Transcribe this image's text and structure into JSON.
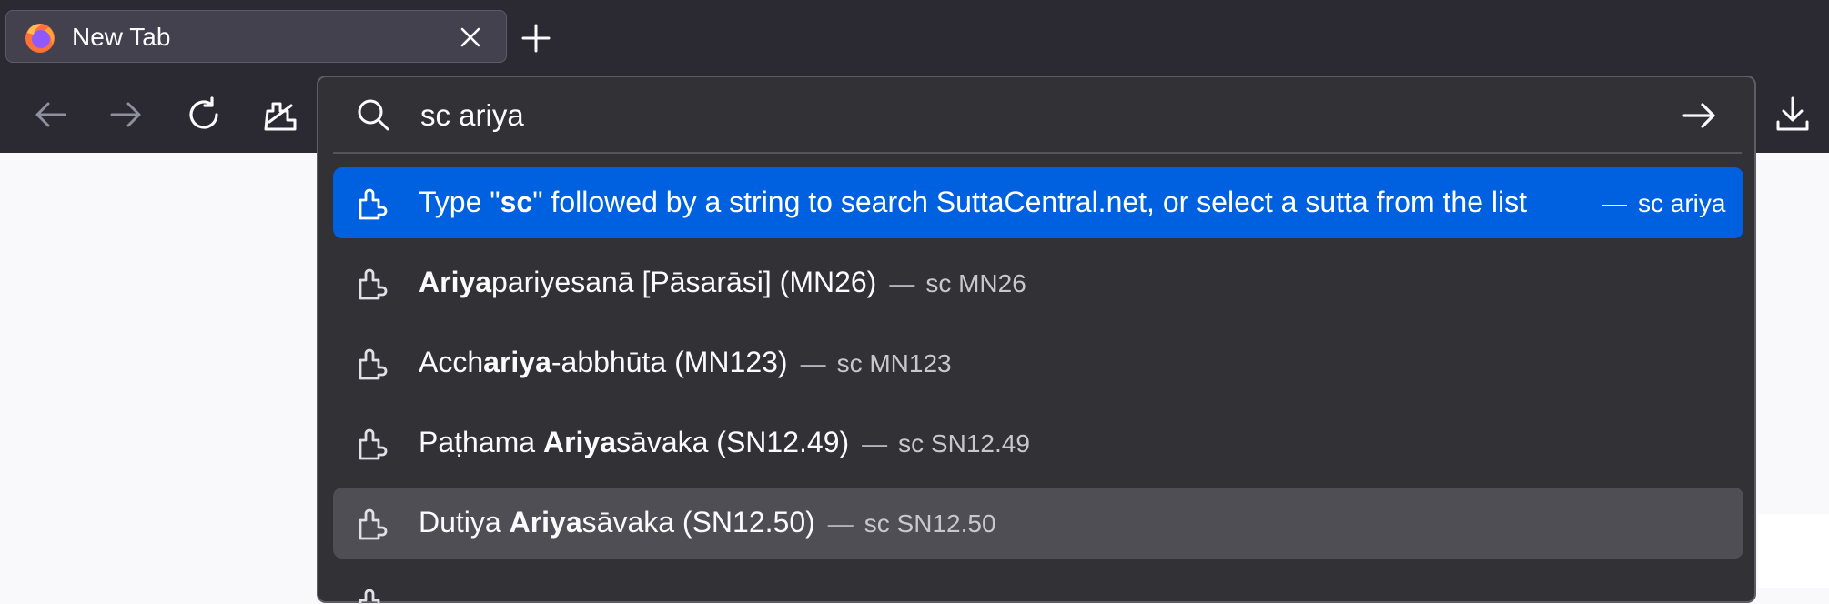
{
  "tab": {
    "title": "New Tab"
  },
  "urlbar": {
    "value": "sc ariya"
  },
  "results": [
    {
      "prefix": "Type \"",
      "bold": "sc",
      "suffix": "\" followed by a string to search SuttaCentral.net, or select a sutta from the list",
      "dash": "—",
      "url": "sc ariya"
    },
    {
      "prefix": "",
      "bold": "Ariya",
      "suffix": "pariyesanā [Pāsarāsi] (MN26)",
      "dash": "—",
      "url": "sc MN26"
    },
    {
      "prefix": "Acch",
      "bold": "ariya",
      "suffix": "-abbhūta (MN123)",
      "dash": "—",
      "url": "sc MN123"
    },
    {
      "prefix": "Paṭhama ",
      "bold": "Ariya",
      "suffix": "sāvaka (SN12.49)",
      "dash": "—",
      "url": "sc SN12.49"
    },
    {
      "prefix": "Dutiya ",
      "bold": "Ariya",
      "suffix": "sāvaka (SN12.50)",
      "dash": "—",
      "url": "sc SN12.50"
    }
  ],
  "colors": {
    "selected": "#0061e0",
    "hovered": "#4f4e55",
    "popup": "#323136",
    "toolbar": "#2b2a33"
  },
  "icons": {
    "favicon": "firefox-logo-icon",
    "close": "close-icon",
    "new_tab": "plus-icon",
    "back": "back-arrow-icon",
    "forward": "forward-arrow-icon",
    "reload": "reload-icon",
    "home": "extension-icon",
    "search": "search-icon",
    "go": "go-arrow-icon",
    "result": "extension-puzzle-icon",
    "download": "download-icon"
  }
}
